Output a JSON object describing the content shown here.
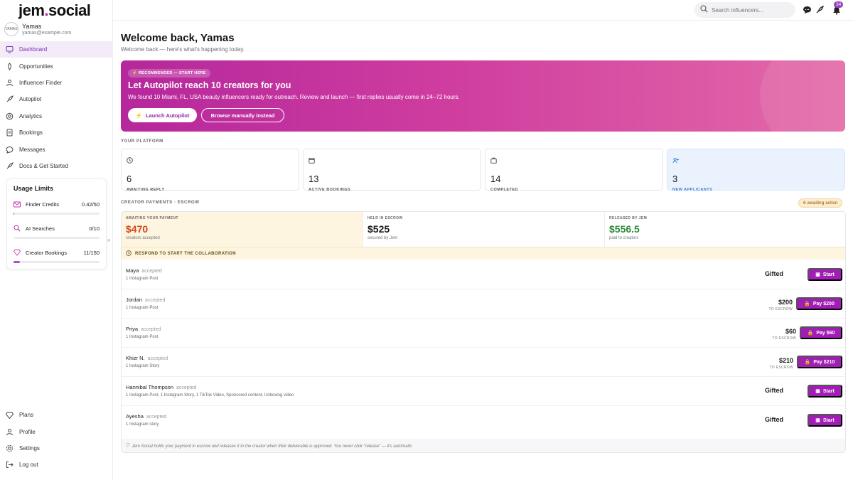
{
  "brand": {
    "name_part1": "jem",
    "dot": ".",
    "name_part2": "social",
    "accent": "#c2189a"
  },
  "user": {
    "avatar_text": "YAMAS",
    "name": "Yamas",
    "email": "yamas@example.com"
  },
  "nav": {
    "items": [
      {
        "label": "Dashboard",
        "icon": "dashboard-icon"
      },
      {
        "label": "Opportunities",
        "icon": "opportunities-icon"
      },
      {
        "label": "Influencer Finder",
        "icon": "finder-icon"
      },
      {
        "label": "Autopilot",
        "icon": "rocket-icon"
      },
      {
        "label": "Analytics",
        "icon": "analytics-icon"
      },
      {
        "label": "Bookings",
        "icon": "bookings-icon"
      },
      {
        "label": "Messages",
        "icon": "messages-icon"
      },
      {
        "label": "Docs & Get Started",
        "icon": "docs-icon"
      }
    ],
    "bottom": [
      {
        "label": "Plans",
        "icon": "diamond-icon"
      },
      {
        "label": "Profile",
        "icon": "profile-icon"
      },
      {
        "label": "Settings",
        "icon": "gear-icon"
      },
      {
        "label": "Log out",
        "icon": "logout-icon"
      }
    ]
  },
  "usage": {
    "title": "Usage Limits",
    "items": [
      {
        "label": "Finder Credits",
        "value": "0.42/50",
        "fraction": 0.0084
      },
      {
        "label": "AI Searches",
        "value": "0/10",
        "fraction": 0
      },
      {
        "label": "Creator Bookings",
        "value": "11/150",
        "fraction": 0.073
      }
    ]
  },
  "topbar": {
    "search_placeholder": "Search influencers...",
    "notification_count": "34"
  },
  "header": {
    "title": "Welcome back, Yamas",
    "subtitle": "Welcome back — here's what's happening today."
  },
  "hero": {
    "tag": "RECOMMENDED — START HERE",
    "title": "Let Autopilot reach 10 creators for you",
    "desc": "We found 10 Miami, FL, USA beauty influencers ready for outreach. Review and launch — first replies usually come in 24–72 hours.",
    "primary": "Launch Autopilot",
    "secondary": "Browse manually instead"
  },
  "platform": {
    "label": "YOUR PLATFORM",
    "stats": [
      {
        "value": "6",
        "label": "AWAITING REPLY",
        "icon": "clock-icon"
      },
      {
        "value": "13",
        "label": "ACTIVE BOOKINGS",
        "icon": "calendar-icon"
      },
      {
        "value": "14",
        "label": "COMPLETED",
        "icon": "briefcase-icon"
      },
      {
        "value": "3",
        "label": "NEW APPLICANTS",
        "icon": "users-icon"
      }
    ]
  },
  "escrow": {
    "label": "CREATOR PAYMENTS · ESCROW",
    "pill": "6 awaiting action",
    "cols": [
      {
        "cap": "AWAITING YOUR PAYMENT",
        "amount": "$470",
        "sub": "creators accepted",
        "color": "#d2461d"
      },
      {
        "cap": "HELD IN ESCROW",
        "amount": "$525",
        "sub": "secured by Jem",
        "color": "#1a1a1a"
      },
      {
        "cap": "RELEASED BY JEM",
        "amount": "$556.5",
        "sub": "paid to creators",
        "color": "#2f8a3a"
      }
    ],
    "respond": "RESPOND TO START THE COLLABORATION",
    "rows": [
      {
        "name": "Maya",
        "status": "accepted",
        "sub": "1 Instagram Post",
        "gifted": "Gifted",
        "price": "",
        "price_sub": "",
        "btn": "Start"
      },
      {
        "name": "Jordan",
        "status": "accepted",
        "sub": "1 Instagram Post",
        "gifted": "",
        "price": "$200",
        "price_sub": "TO ESCROW",
        "btn": "Pay $200"
      },
      {
        "name": "Priya",
        "status": "accepted",
        "sub": "1 Instagram Post",
        "gifted": "",
        "price": "$60",
        "price_sub": "TO ESCROW",
        "btn": "Pay $60"
      },
      {
        "name": "Khizr N.",
        "status": "accepted",
        "sub": "1 Instagram Story",
        "gifted": "",
        "price": "$210",
        "price_sub": "TO ESCROW",
        "btn": "Pay $210"
      },
      {
        "name": "Hannibal Thompson",
        "status": "accepted",
        "sub": "1 Instagram Post, 1 Instagram Story, 1 TikTok Video, Sponsored content, Unboxing video",
        "gifted": "Gifted",
        "price": "",
        "price_sub": "",
        "btn": "Start"
      },
      {
        "name": "Ayesha",
        "status": "accepted",
        "sub": "1 Instagram story",
        "gifted": "Gifted",
        "price": "",
        "price_sub": "",
        "btn": "Start"
      }
    ],
    "footnote": "Jem Social holds your payment in escrow and releases it to the creator when their deliverable is approved. You never click “release” — it's automatic."
  }
}
